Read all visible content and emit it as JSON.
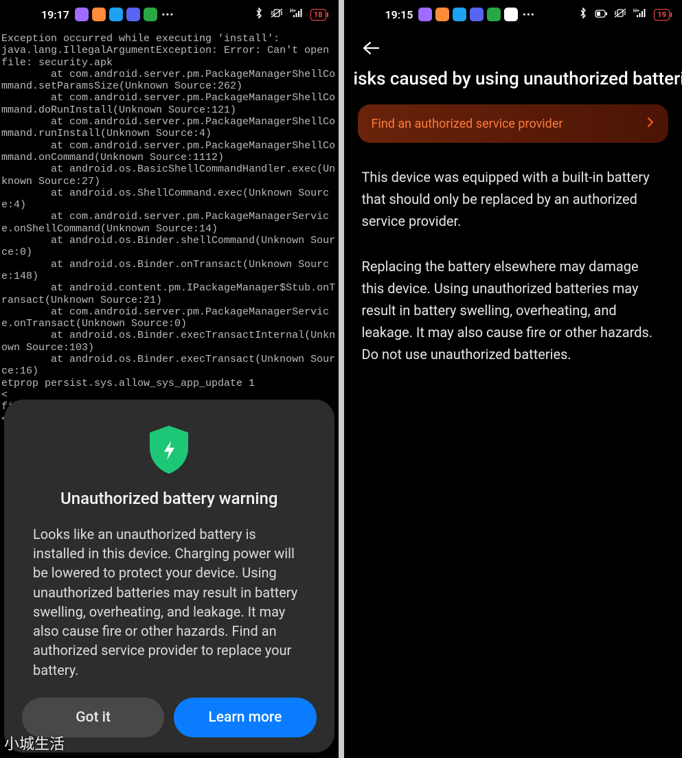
{
  "left": {
    "status": {
      "time": "19:17",
      "battery": "18",
      "app_colors": [
        "#a06bff",
        "#ff8c3a",
        "#1da1f2",
        "#5865f2",
        "#28a745"
      ]
    },
    "terminal": "Exception occurred while executing 'install':\njava.lang.IllegalArgumentException: Error: Can't open file: security.apk\n        at com.android.server.pm.PackageManagerShellCommand.setParamsSize(Unknown Source:262)\n        at com.android.server.pm.PackageManagerShellCommand.doRunInstall(Unknown Source:121)\n        at com.android.server.pm.PackageManagerShellCommand.runInstall(Unknown Source:4)\n        at com.android.server.pm.PackageManagerShellCommand.onCommand(Unknown Source:1112)\n        at android.os.BasicShellCommandHandler.exec(Unknown Source:27)\n        at android.os.ShellCommand.exec(Unknown Source:4)\n        at com.android.server.pm.PackageManagerService.onShellCommand(Unknown Source:14)\n        at android.os.Binder.shellCommand(Unknown Source:0)\n        at android.os.Binder.onTransact(Unknown Source:148)\n        at android.content.pm.IPackageManager$Stub.onTransact(Unknown Source:21)\n        at com.android.server.pm.PackageManagerService.onTransact(Unknown Source:0)\n        at android.os.Binder.execTransactInternal(Unknown Source:103)\n        at android.os.Binder.execTransact(Unknown Source:16)\netprop persist.sys.allow_sys_app_update 1              <\nficalbattery.UnofficalBatteryActivity                  <",
    "dialog": {
      "title": "Unauthorized battery warning",
      "body": "Looks like an unauthorized battery is installed in this device. Charging power will be lowered to protect your device. Using unauthorized batteries may result in battery swelling, overheating, and leakage. It may also cause fire or other hazards. Find an authorized service provider to replace your battery.",
      "got_it": "Got it",
      "learn_more": "Learn more",
      "shield_color": "#1ec776"
    }
  },
  "right": {
    "status": {
      "time": "19:15",
      "battery": "19",
      "app_colors": [
        "#a06bff",
        "#ff8c3a",
        "#1da1f2",
        "#5865f2",
        "#28a745",
        "#ffffff"
      ]
    },
    "title": "isks caused by using unauthorized batterie",
    "cta": "Find an authorized service provider",
    "para1": "This device was equipped with a built-in battery that should only be replaced by an authorized service provider.",
    "para2": "Replacing the battery elsewhere may damage this device. Using unauthorized batteries may result in battery swelling, overheating, and leakage. It may also cause fire or other hazards. Do not use unauthorized batteries."
  },
  "watermark": "小城生活"
}
